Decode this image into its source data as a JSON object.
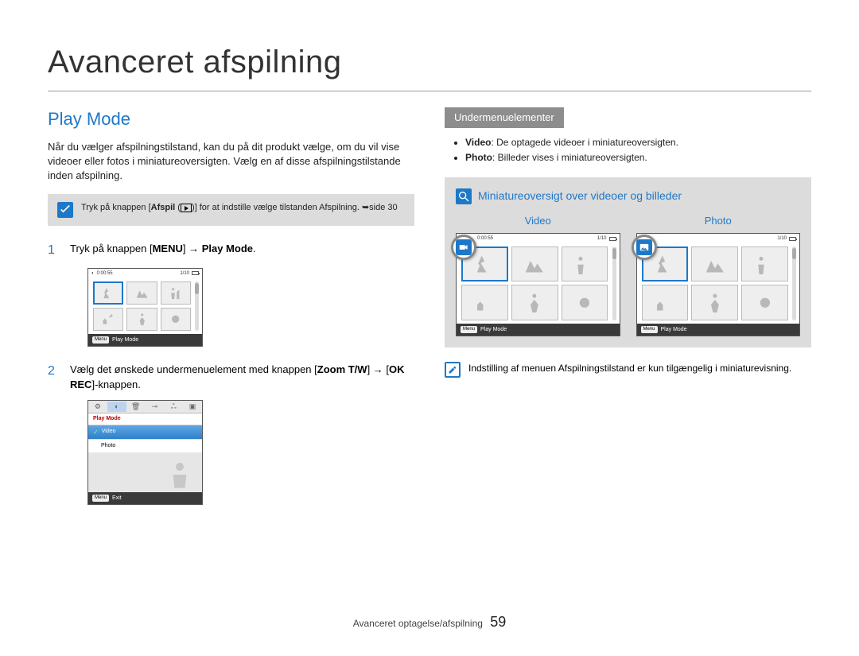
{
  "page_title": "Avanceret afspilning",
  "section_heading": "Play Mode",
  "intro": "Når du vælger afspilningstilstand, kan du på dit produkt vælge, om du vil vise videoer eller fotos i miniatureoversigten. Vælg en af disse afspilningstilstande inden afspilning.",
  "callout_tip": {
    "pre": "Tryk på knappen [",
    "bold1": "Afspil",
    "mid": " (",
    "post_icon": ")] for at indstille vælge tilstanden Afspilning. ➥side 30"
  },
  "steps": [
    {
      "num": "1",
      "pre": "Tryk på knappen [",
      "bold1": "MENU",
      "mid": "] → ",
      "bold2": "Play Mode",
      "post": "."
    },
    {
      "num": "2",
      "pre": "Vælg det ønskede undermenuelement med knappen [",
      "bold1": "Zoom T/W",
      "mid": "] → [",
      "bold2": "OK REC",
      "post": "]-knappen."
    }
  ],
  "screenshot1": {
    "time": "0:00:55",
    "counter": "1/10",
    "footer_label": "Play Mode",
    "menu_button": "Menu"
  },
  "menu_shot": {
    "header": "Play Mode",
    "item_selected": "Video",
    "item2": "Photo",
    "footer_label": "Exit",
    "menu_button": "Menu"
  },
  "right": {
    "submenu_heading": "Undermenuelementer",
    "bullets": [
      {
        "bold": "Video",
        "text": ": De optagede videoer i miniatureoversigten."
      },
      {
        "bold": "Photo",
        "text": ": Billeder vises i miniatureoversigten."
      }
    ],
    "mini_heading": "Miniatureoversigt over videoer og billeder",
    "preview_video_label": "Video",
    "preview_photo_label": "Photo",
    "preview_time": "0:00:55",
    "preview_counter": "1/10",
    "preview_footer": "Play Mode",
    "preview_menu_button": "Menu",
    "note": "Indstilling af menuen Afspilningstilstand er kun tilgængelig i miniaturevisning."
  },
  "footer": {
    "breadcrumb": "Avanceret optagelse/afspilning",
    "page_number": "59"
  }
}
